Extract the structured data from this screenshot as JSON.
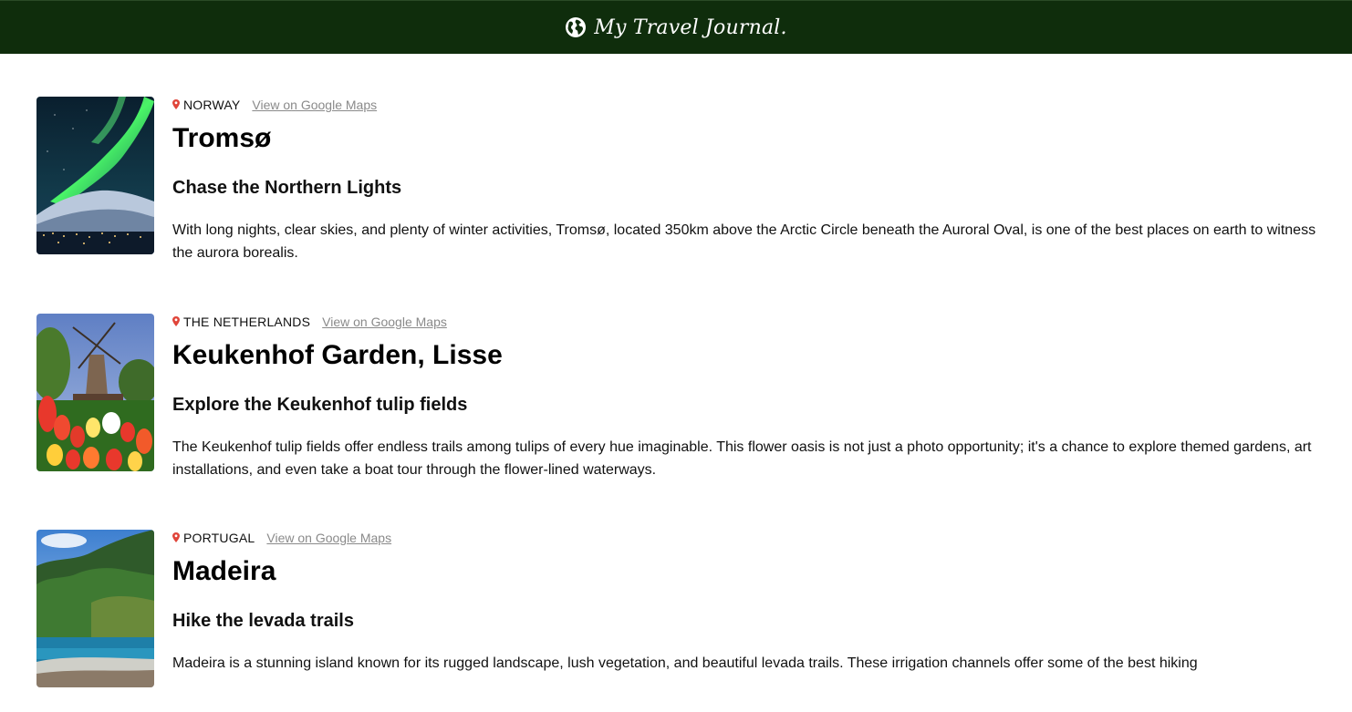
{
  "header": {
    "title": "My Travel Journal."
  },
  "entries": [
    {
      "country": "NORWAY",
      "maps_link": "View on Google Maps",
      "place": "Tromsø",
      "tagline": "Chase the Northern Lights",
      "description": "With long nights, clear skies, and plenty of winter activities, Tromsø, located 350km above the Arctic Circle beneath the Auroral Oval, is one of the best places on earth to witness the aurora borealis."
    },
    {
      "country": "THE NETHERLANDS",
      "maps_link": "View on Google Maps",
      "place": "Keukenhof Garden, Lisse",
      "tagline": "Explore the Keukenhof tulip fields",
      "description": "The Keukenhof tulip fields offer endless trails among tulips of every hue imaginable. This flower oasis is not just a photo opportunity; it's a chance to explore themed gardens, art installations, and even take a boat tour through the flower-lined waterways."
    },
    {
      "country": "PORTUGAL",
      "maps_link": "View on Google Maps",
      "place": "Madeira",
      "tagline": "Hike the levada trails",
      "description": "Madeira is a stunning island known for its rugged landscape, lush vegetation, and beautiful levada trails. These irrigation channels offer some of the best hiking"
    }
  ],
  "colors": {
    "header_bg": "#0f2d0c",
    "pin": "#e0453a",
    "link": "#8a8a8a"
  },
  "icons": {
    "brand": "globe-icon",
    "location": "map-pin-icon"
  }
}
